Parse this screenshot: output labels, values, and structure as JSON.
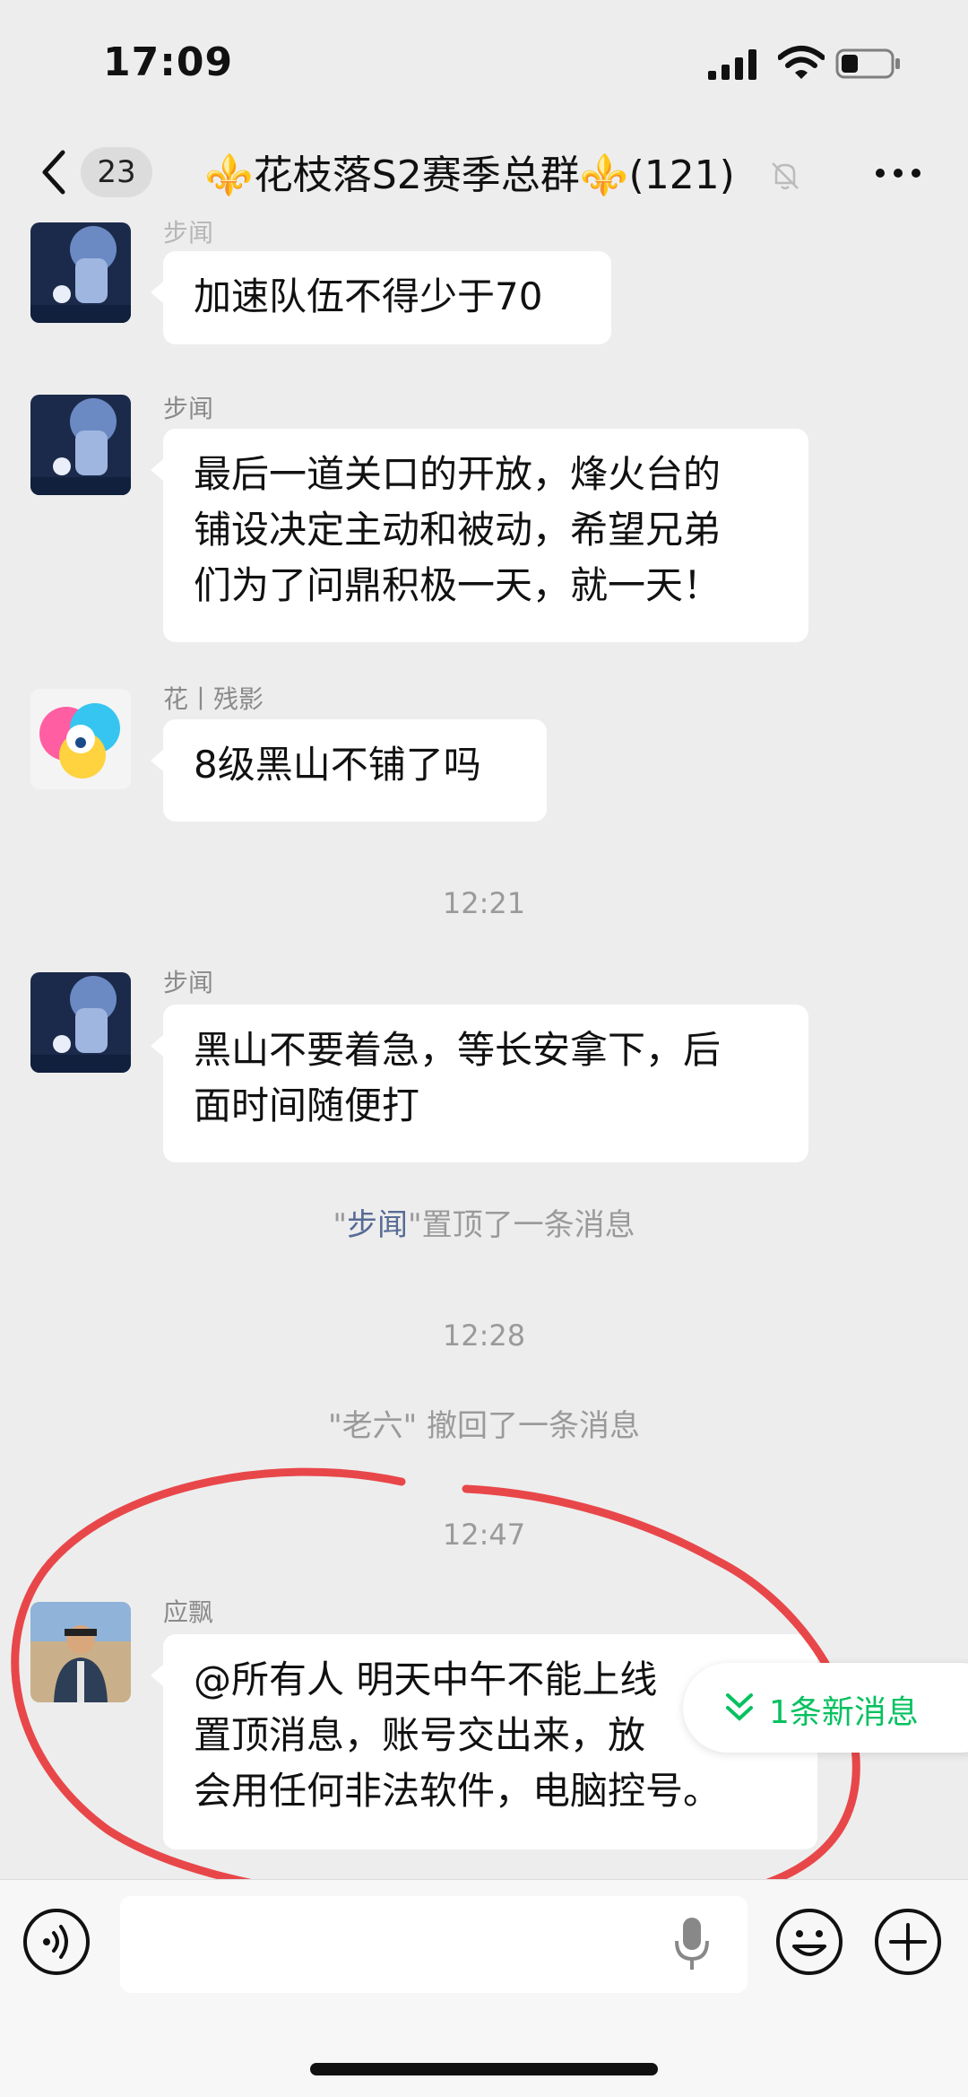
{
  "status_bar": {
    "time": "17:09"
  },
  "header": {
    "unread_count": "23",
    "title_prefix_emoji": "⚜️",
    "title": "花枝落S2赛季总群",
    "title_suffix_emoji": "⚜️",
    "member_count": "(121)"
  },
  "messages": [
    {
      "sender": "步闻",
      "lines": [
        "加速队伍不得少于70"
      ]
    },
    {
      "sender": "步闻",
      "lines": [
        "最后一道关口的开放，烽火台的",
        "铺设决定主动和被动，希望兄弟",
        "们为了问鼎积极一天，就一天！"
      ]
    },
    {
      "sender": "花丨残影",
      "lines": [
        "8级黑山不铺了吗"
      ]
    },
    {
      "sender": "步闻",
      "lines": [
        "黑山不要着急，等长安拿下，后",
        "面时间随便打"
      ]
    },
    {
      "sender": "应飘",
      "lines": [
        "@所有人 明天中午不能上线",
        "置顶消息，账号交出来，放",
        "会用任何非法软件，电脑控号。"
      ]
    }
  ],
  "timestamps": [
    "12:21",
    "12:28",
    "12:47"
  ],
  "system": {
    "pinned_name": "步闻",
    "pinned_quote_open": "\"",
    "pinned_quote_close": "\"",
    "pinned_text": "置顶了一条消息",
    "recall_name": "\"老六\"",
    "recall_text": " 撤回了一条消息"
  },
  "new_messages_label": "1条新消息",
  "colors": {
    "accent_green": "#07c160",
    "name_blue": "#576b95",
    "annotation_red": "#e8474a"
  }
}
